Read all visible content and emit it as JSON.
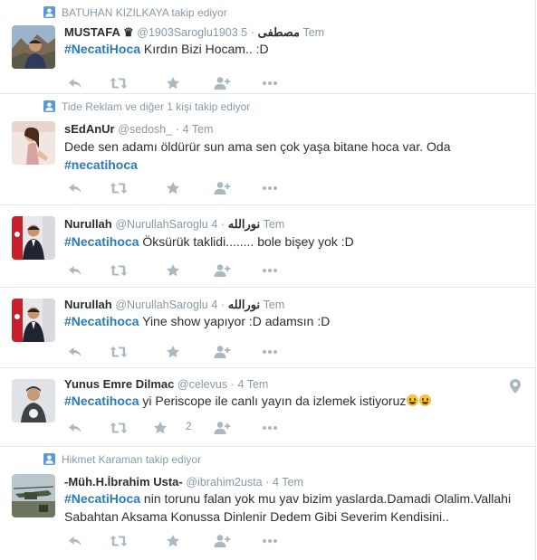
{
  "tweets": [
    {
      "context": "BATUHAN KIZILKAYA takip ediyor",
      "name": "MUSTAFA ♛",
      "screen": "@1903Saroglu1903",
      "arabic": "مصطفى",
      "time": "5 Tem",
      "hashtag": "#NecatiHoca",
      "text": " Kırdın Bizi Hocam.. :D"
    },
    {
      "context": "Tide Reklam ve diğer 1 kişi takip ediyor",
      "name": "sEdAnUr",
      "screen": "@sedosh_",
      "time": "4 Tem",
      "line1": "Dede sen adamı öldürür sun ama sen çok yaşa  bitane hoca var. Oda",
      "hashtag": "#necatihoca"
    },
    {
      "name": "Nurullah",
      "screen": "@NurullahSaroglu",
      "arabic": "نورالله",
      "time": "4 Tem",
      "hashtag": "#Necatihoca",
      "text": " Öksürük taklidi........ bole bişey yok :D"
    },
    {
      "name": "Nurullah",
      "screen": "@NurullahSaroglu",
      "arabic": "نورالله",
      "time": "4 Tem",
      "hashtag": "#Necatihoca",
      "text": " Yine show yapıyor :D adamsın :D"
    },
    {
      "name": "Yunus Emre Dilmac",
      "screen": "@celevus",
      "time": "4 Tem",
      "hashtag": "#Necatihoca",
      "text": " yi Periscope ile canlı yayın da izlemek istiyoruz",
      "retweet_count": "2"
    },
    {
      "context": "Hikmet Karaman takip ediyor",
      "name": "-Müh.H.İbrahim Usta-",
      "screen": "@ibrahim2usta",
      "time": "4 Tem",
      "hashtag": "#NecatiHoca",
      "text": " nin torunu falan yok mu yav bizim yaslarda.Damadi Olalim.Vallahi",
      "line2": "Sabahtan Aksama Konussa Dinlenir Dedem Gibi Severim Kendisini.."
    }
  ],
  "colors": {
    "hashtag": "#2b7bb9",
    "muted": "#8899a6",
    "action_icon": "#aab8c2",
    "context_icon": "#5b9bd5",
    "border": "#e1e8ed"
  },
  "icons": [
    "person-icon",
    "reply-icon",
    "retweet-icon",
    "favorite-icon",
    "follow-icon",
    "more-icon",
    "location-pin-icon",
    "grinning-face-emoji"
  ]
}
